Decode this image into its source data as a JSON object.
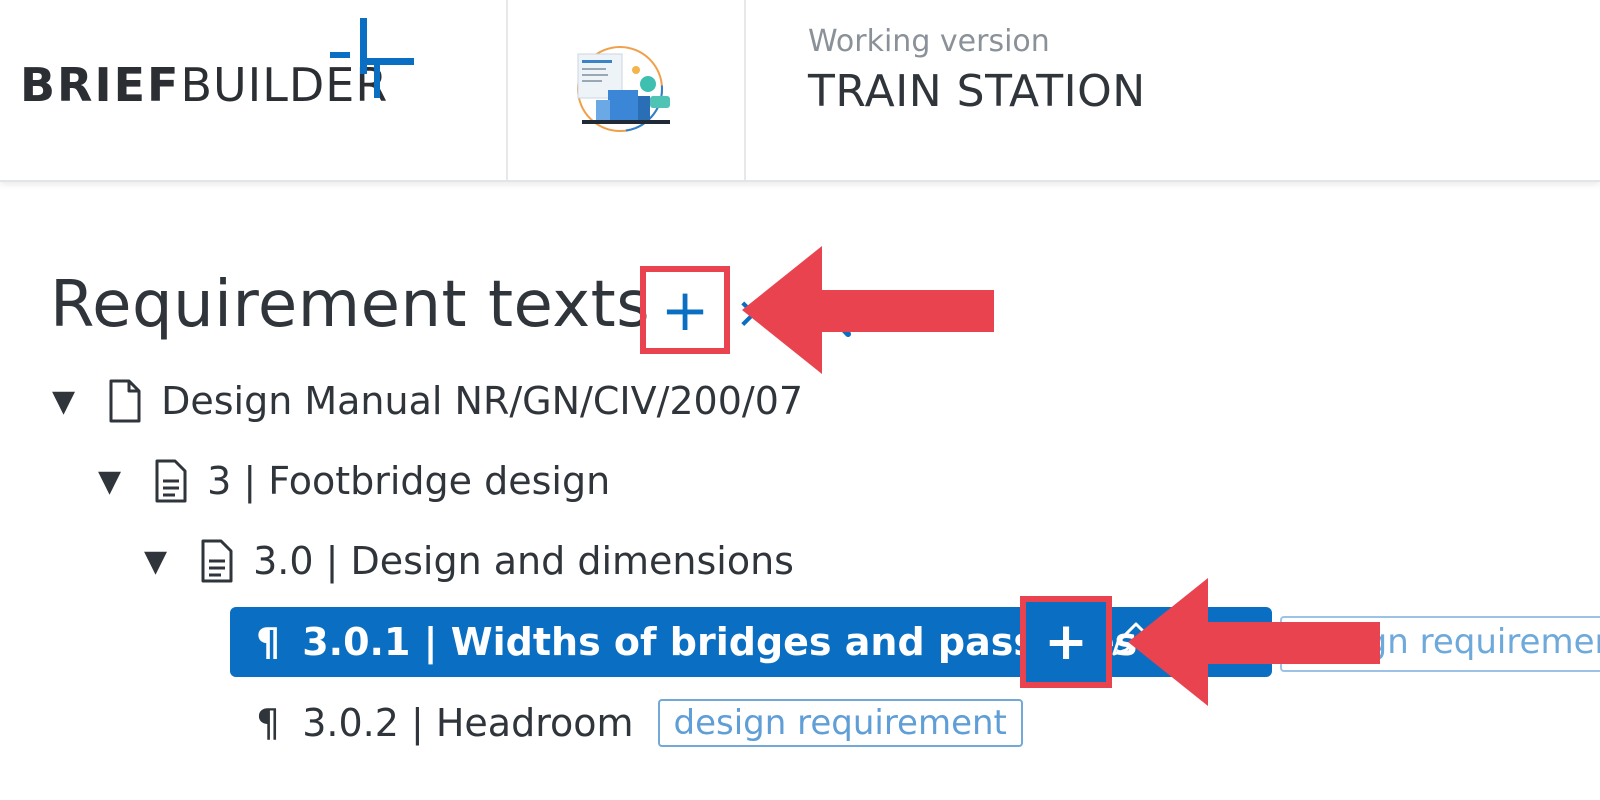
{
  "brand": {
    "logo_bold": "BRIEF",
    "logo_light": "BUILDER",
    "accent": "#0a6fc2"
  },
  "header": {
    "version_label": "Working version",
    "project_name": "TRAIN STATION",
    "thumbnail_icon": "project-illustration"
  },
  "main": {
    "title": "Requirement texts",
    "add_label": "+",
    "collapse_icon": "collapse-all-icon",
    "search_icon": "search-icon"
  },
  "tree": {
    "root": {
      "label": "Design Manual NR/GN/CIV/200/07"
    },
    "chapter": {
      "label": "3 | Footbridge design"
    },
    "section": {
      "label": "3.0 | Design and dimensions"
    },
    "selected": {
      "label": "3.0.1 | Widths of bridges and passages",
      "add_label": "+",
      "tag": "design requirement"
    },
    "item2": {
      "label": "3.0.2 | Headroom",
      "tag": "design requirement"
    }
  },
  "colors": {
    "highlight": "#e8434e",
    "selected_bg": "#0a6fc2",
    "tag_border": "#73a9d8"
  }
}
